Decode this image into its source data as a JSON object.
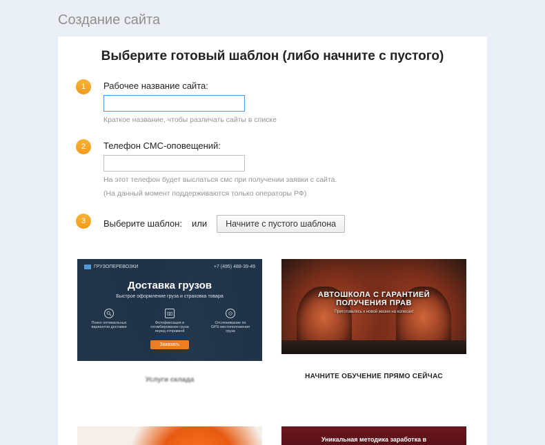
{
  "page_header": "Создание сайта",
  "card_title": "Выберите готовый шаблон (либо начните с пустого)",
  "steps": {
    "s1": {
      "num": "1",
      "label": "Рабочее название сайта:",
      "value": "",
      "hint": "Краткое название, чтобы различать сайты в списке"
    },
    "s2": {
      "num": "2",
      "label": "Телефон СМС-оповещений:",
      "value": "",
      "hint1": "На этот телефон будет выслаться смс при получении заявки с сайта.",
      "hint2": "(На данный момент поддерживаются только операторы РФ)"
    },
    "s3": {
      "num": "3",
      "label": "Выберите шаблон:",
      "or": "или",
      "btn": "Начните с пустого шаблона"
    }
  },
  "templates": {
    "t1": {
      "brand": "ГРУЗОПЕРЕВОЗКИ",
      "phone": "+7 (495) 488-39-49",
      "heading": "Доставка грузов",
      "sub": "Быстрое оформление груза и страховка товара",
      "feat1": "Поиск оптимальных вариантов доставки",
      "feat2": "Фотофиксация и пломбирование груза перед отправкой",
      "feat3": "Отслеживание по GPS местоположения груза",
      "btn": "Заказать",
      "bottom": "Услуги склада"
    },
    "t2": {
      "heading_l1": "АВТОШКОЛА С ГАРАНТИЕЙ",
      "heading_l2": "ПОЛУЧЕНИЯ ПРАВ",
      "sub": "Приготовьтесь к новой жизни на колесах!",
      "bottom": "НАЧНИТЕ ОБУЧЕНИЕ ПРЯМО СЕЙЧАС"
    },
    "t4": {
      "heading": "Уникальная методика заработка в"
    }
  }
}
